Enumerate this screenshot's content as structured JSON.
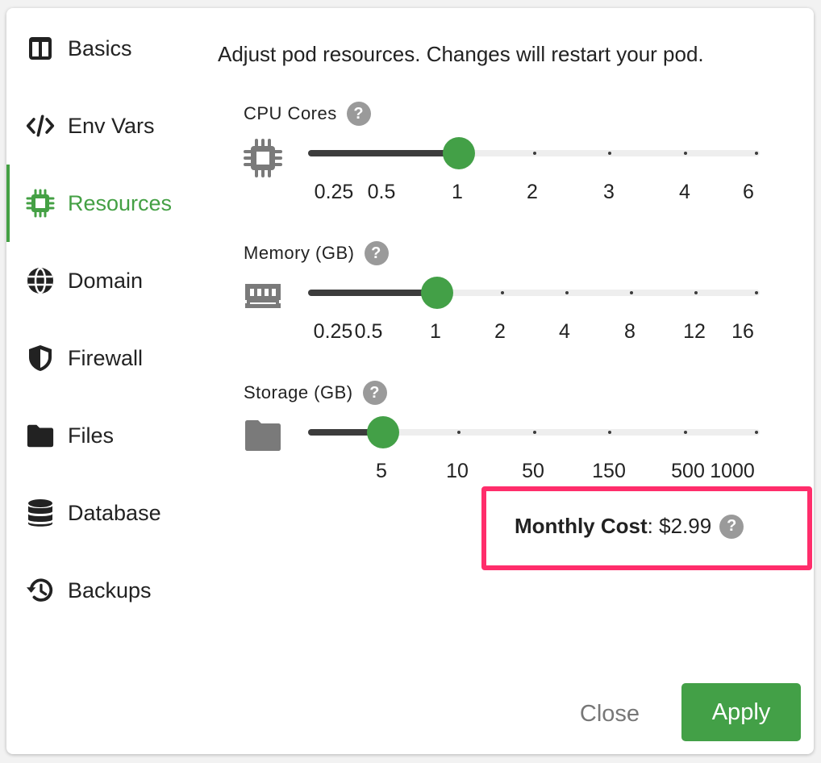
{
  "sidebar": {
    "items": [
      {
        "label": "Basics",
        "icon": "columns-icon"
      },
      {
        "label": "Env Vars",
        "icon": "code-icon"
      },
      {
        "label": "Resources",
        "icon": "cpu-icon",
        "active": true
      },
      {
        "label": "Domain",
        "icon": "globe-icon"
      },
      {
        "label": "Firewall",
        "icon": "shield-icon"
      },
      {
        "label": "Files",
        "icon": "folder-icon"
      },
      {
        "label": "Database",
        "icon": "database-icon"
      },
      {
        "label": "Backups",
        "icon": "history-icon"
      }
    ]
  },
  "main": {
    "description": "Adjust pod resources. Changes will restart your pod.",
    "cpu": {
      "label": "CPU Cores",
      "help": "?",
      "ticks": [
        "0.25",
        "0.5",
        "1",
        "2",
        "3",
        "4",
        "6"
      ],
      "value": "1"
    },
    "memory": {
      "label": "Memory (GB)",
      "help": "?",
      "ticks": [
        "0.25",
        "0.5",
        "1",
        "2",
        "4",
        "8",
        "12",
        "16"
      ],
      "value": "1"
    },
    "storage": {
      "label": "Storage (GB)",
      "help": "?",
      "ticks": [
        "5",
        "10",
        "50",
        "150",
        "500",
        "1000"
      ],
      "value": "5"
    },
    "cost": {
      "label": "Monthly Cost",
      "separator": ":",
      "value": "$2.99",
      "help": "?"
    }
  },
  "footer": {
    "close_label": "Close",
    "apply_label": "Apply"
  },
  "colors": {
    "accent": "#43a047",
    "highlight": "#ff2d6b",
    "track_fill": "#3c3c3c"
  }
}
